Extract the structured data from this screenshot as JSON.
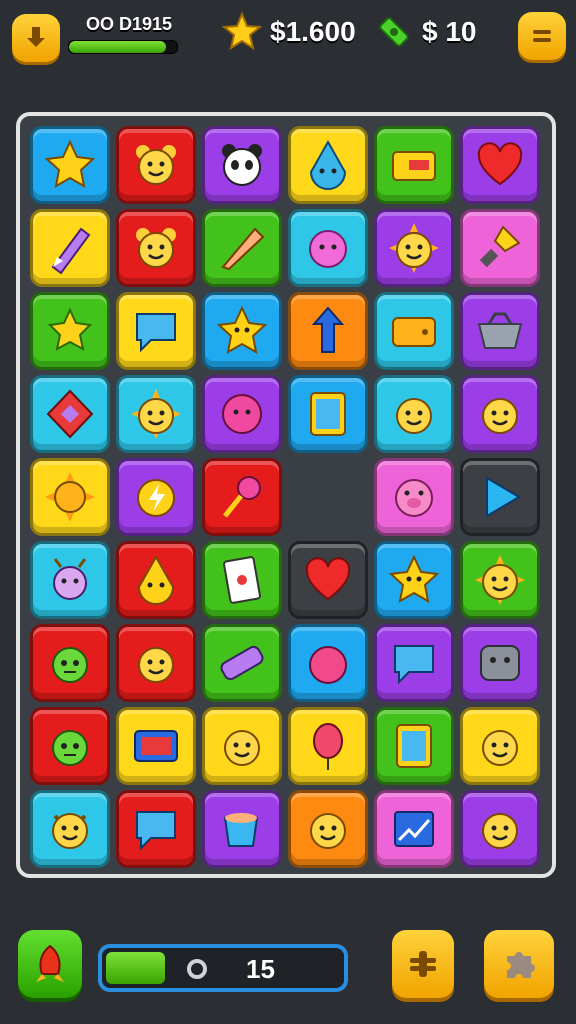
{
  "hud": {
    "player_code": "OO D1915",
    "coins": "$1.600",
    "cash": "$ 10",
    "xp_progress": 0.9
  },
  "board": {
    "colors": {
      "blue": "#1fa9f0",
      "red": "#e51c1c",
      "purple": "#9b3ee8",
      "yellow": "#ffd81a",
      "green": "#42c21a",
      "cyan": "#2fc7e8",
      "pink": "#ee64d8",
      "orange": "#ff8a12",
      "dark": "#3c3f44",
      "empty": "transparent"
    },
    "rows": [
      [
        {
          "c": "blue",
          "icon": "star-icon"
        },
        {
          "c": "red",
          "icon": "bear-face-icon"
        },
        {
          "c": "purple",
          "icon": "panda-face-icon"
        },
        {
          "c": "yellow",
          "icon": "drop-icon"
        },
        {
          "c": "green",
          "icon": "card-icon"
        },
        {
          "c": "purple",
          "icon": "heart-icon"
        }
      ],
      [
        {
          "c": "yellow",
          "icon": "crayon-icon"
        },
        {
          "c": "red",
          "icon": "bear-face-icon"
        },
        {
          "c": "green",
          "icon": "pencil-icon"
        },
        {
          "c": "cyan",
          "icon": "fluffy-monster-icon"
        },
        {
          "c": "purple",
          "icon": "sun-face-icon"
        },
        {
          "c": "pink",
          "icon": "flashlight-icon"
        }
      ],
      [
        {
          "c": "green",
          "icon": "leaf-star-icon"
        },
        {
          "c": "yellow",
          "icon": "speech-bubble-icon"
        },
        {
          "c": "blue",
          "icon": "star-face-icon"
        },
        {
          "c": "orange",
          "icon": "arrow-up-icon"
        },
        {
          "c": "cyan",
          "icon": "wallet-icon"
        },
        {
          "c": "purple",
          "icon": "basket-icon"
        }
      ],
      [
        {
          "c": "cyan",
          "icon": "diamond-shape-icon"
        },
        {
          "c": "cyan",
          "icon": "sun-face-icon"
        },
        {
          "c": "purple",
          "icon": "ball-face-icon"
        },
        {
          "c": "blue",
          "icon": "tablet-icon"
        },
        {
          "c": "cyan",
          "icon": "smiley-icon"
        },
        {
          "c": "purple",
          "icon": "smiley-icon"
        }
      ],
      [
        {
          "c": "yellow",
          "icon": "sun-icon"
        },
        {
          "c": "purple",
          "icon": "lightning-face-icon"
        },
        {
          "c": "red",
          "icon": "lollipop-icon"
        },
        {
          "c": "empty",
          "icon": ""
        },
        {
          "c": "pink",
          "icon": "pig-face-icon"
        },
        {
          "c": "dark",
          "icon": "play-icon"
        }
      ],
      [
        {
          "c": "cyan",
          "icon": "bug-face-icon"
        },
        {
          "c": "red",
          "icon": "drop-face-icon"
        },
        {
          "c": "green",
          "icon": "playing-card-icon"
        },
        {
          "c": "dark",
          "icon": "heart-icon"
        },
        {
          "c": "blue",
          "icon": "star-face-icon"
        },
        {
          "c": "green",
          "icon": "sun-face-icon"
        }
      ],
      [
        {
          "c": "red",
          "icon": "monster-face-icon"
        },
        {
          "c": "red",
          "icon": "smiley-icon"
        },
        {
          "c": "green",
          "icon": "bandage-icon"
        },
        {
          "c": "blue",
          "icon": "ball-icon"
        },
        {
          "c": "purple",
          "icon": "speech-bubble-icon"
        },
        {
          "c": "purple",
          "icon": "robot-face-icon"
        }
      ],
      [
        {
          "c": "red",
          "icon": "monster-face-icon"
        },
        {
          "c": "yellow",
          "icon": "tv-icon"
        },
        {
          "c": "yellow",
          "icon": "smiley-icon"
        },
        {
          "c": "yellow",
          "icon": "balloon-icon"
        },
        {
          "c": "green",
          "icon": "tablet-icon"
        },
        {
          "c": "yellow",
          "icon": "smiley-icon"
        }
      ],
      [
        {
          "c": "cyan",
          "icon": "cat-face-icon"
        },
        {
          "c": "red",
          "icon": "speech-bubble-icon"
        },
        {
          "c": "purple",
          "icon": "cup-icon"
        },
        {
          "c": "orange",
          "icon": "smiley-icon"
        },
        {
          "c": "pink",
          "icon": "chart-icon"
        },
        {
          "c": "purple",
          "icon": "smiley-icon"
        }
      ]
    ]
  },
  "footer": {
    "moves": "15",
    "moves_progress": 0.25
  }
}
